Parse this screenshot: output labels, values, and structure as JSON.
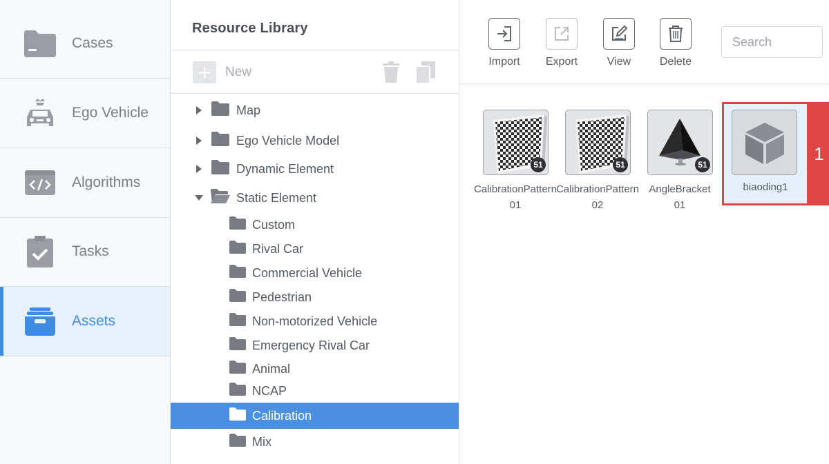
{
  "nav": {
    "items": [
      {
        "label": "Cases",
        "icon": "folder-icon"
      },
      {
        "label": "Ego Vehicle",
        "icon": "car-icon"
      },
      {
        "label": "Algorithms",
        "icon": "code-icon"
      },
      {
        "label": "Tasks",
        "icon": "clipboard-check-icon"
      },
      {
        "label": "Assets",
        "icon": "drawer-icon",
        "active": true
      }
    ]
  },
  "library": {
    "title": "Resource Library",
    "new_label": "New",
    "tree": [
      {
        "label": "Map",
        "level": 0,
        "expanded": false
      },
      {
        "label": "Ego Vehicle Model",
        "level": 0,
        "expanded": false
      },
      {
        "label": "Dynamic Element",
        "level": 0,
        "expanded": false
      },
      {
        "label": "Static Element",
        "level": 0,
        "expanded": true
      },
      {
        "label": "Custom",
        "level": 1
      },
      {
        "label": "Rival Car",
        "level": 1
      },
      {
        "label": "Commercial Vehicle",
        "level": 1
      },
      {
        "label": "Pedestrian",
        "level": 1
      },
      {
        "label": "Non-motorized Vehicle",
        "level": 1
      },
      {
        "label": "Emergency Rival Car",
        "level": 1
      },
      {
        "label": "Animal",
        "level": 1
      },
      {
        "label": "NCAP",
        "level": 1
      },
      {
        "label": "Calibration",
        "level": 1,
        "selected": true
      },
      {
        "label": "Mix",
        "level": 1
      }
    ]
  },
  "toolbar": {
    "import_label": "Import",
    "export_label": "Export",
    "view_label": "View",
    "delete_label": "Delete",
    "search_placeholder": "Search"
  },
  "assets": [
    {
      "name_line1": "CalibrationPattern",
      "name_line2": "01",
      "badge": "51",
      "kind": "checkerboard"
    },
    {
      "name_line1": "CalibrationPattern",
      "name_line2": "02",
      "badge": "51",
      "kind": "checkerboard"
    },
    {
      "name_line1": "AngleBracket",
      "name_line2": "01",
      "badge": "51",
      "kind": "pyramid"
    },
    {
      "name_line1": "biaoding1",
      "name_line2": "",
      "kind": "cube",
      "selected": true
    }
  ],
  "selection_marker": "1",
  "colors": {
    "accent": "#3f8de3",
    "selected_row": "#4a8fe0",
    "highlight_red": "#e04545"
  }
}
